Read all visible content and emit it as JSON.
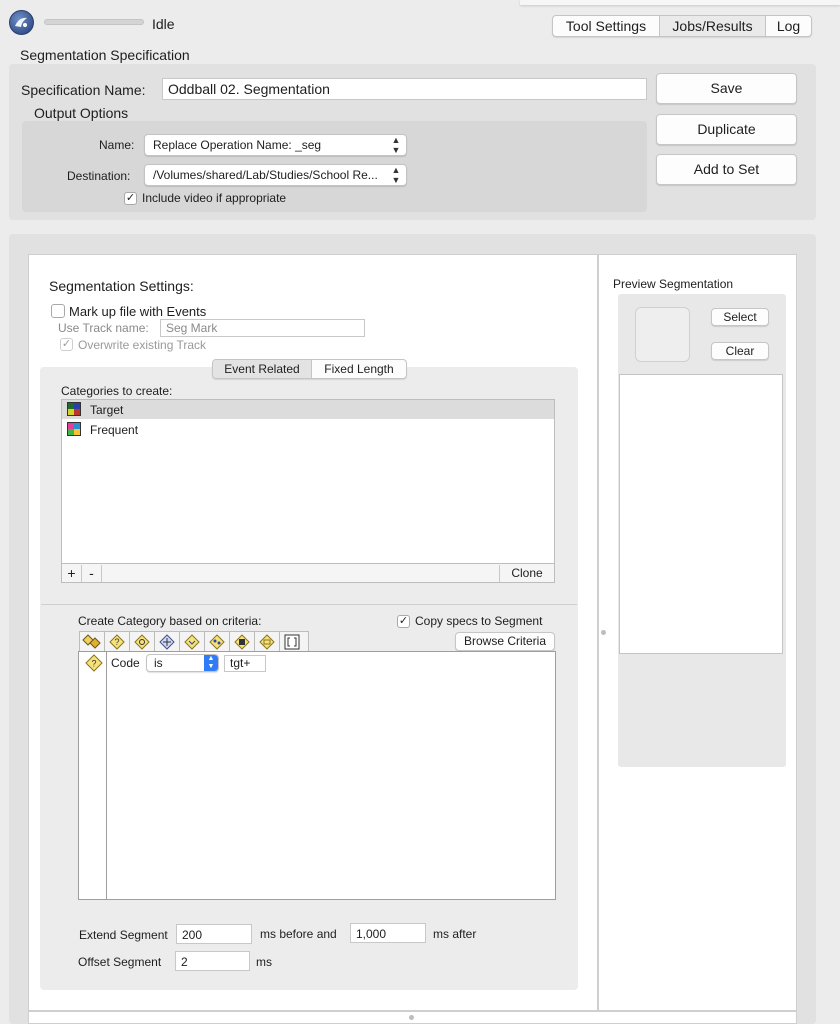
{
  "window": {
    "status": "Idle",
    "tabs": [
      "Tool Settings",
      "Jobs/Results",
      "Log"
    ],
    "selected_tab": "Tool Settings"
  },
  "spec": {
    "section_title": "Segmentation Specification",
    "name_label": "Specification Name:",
    "name_value": "Oddball 02. Segmentation",
    "buttons": {
      "save": "Save",
      "duplicate": "Duplicate",
      "add_to_set": "Add to Set"
    },
    "output_options": {
      "title": "Output Options",
      "name_label": "Name:",
      "name_value": "Replace Operation Name: _seg",
      "destination_label": "Destination:",
      "destination_value": "/Volumes/shared/Lab/Studies/School Re...",
      "include_video_label": "Include video if appropriate",
      "include_video_checked": true
    }
  },
  "segmentation": {
    "title": "Segmentation Settings:",
    "markup_label": "Mark up file with Events",
    "markup_checked": false,
    "track_label": "Use Track name:",
    "track_placeholder": "Seg Mark",
    "overwrite_label": "Overwrite existing Track",
    "overwrite_checked": true,
    "mode_tabs": [
      "Event Related",
      "Fixed Length"
    ],
    "selected_mode": "Event Related",
    "categories_label": "Categories to create:",
    "categories": [
      {
        "name": "Target",
        "selected": true,
        "colors": [
          "#1e6b2a",
          "#2b3fa8",
          "#d2d22a",
          "#b8362c"
        ]
      },
      {
        "name": "Frequent",
        "selected": false,
        "colors": [
          "#e73d9a",
          "#2a8fd6",
          "#43b649",
          "#f4c431"
        ]
      }
    ],
    "add_label": "+",
    "remove_label": "-",
    "clone_label": "Clone",
    "criteria_label": "Create Category based on criteria:",
    "copy_specs_label": "Copy specs to Segment",
    "copy_specs_checked": true,
    "browse_label": "Browse Criteria",
    "criteria_toolbar_icons": [
      "and-or-icon",
      "question-diamond-icon",
      "target-diamond-icon",
      "crosshair-diamond-icon",
      "code-diamond-icon",
      "net-diamond-icon",
      "chip-diamond-icon",
      "label-diamond-icon",
      "brackets-icon"
    ],
    "criteria_row": {
      "field": "Code",
      "operator": "is",
      "value": "tgt+"
    },
    "extend_label": "Extend Segment",
    "extend_before": "200",
    "before_unit": "ms before and",
    "extend_after": "1,000",
    "after_unit": "ms after",
    "offset_label": "Offset Segment",
    "offset_value": "2",
    "offset_unit": "ms"
  },
  "preview": {
    "title": "Preview Segmentation",
    "select_label": "Select",
    "clear_label": "Clear"
  }
}
